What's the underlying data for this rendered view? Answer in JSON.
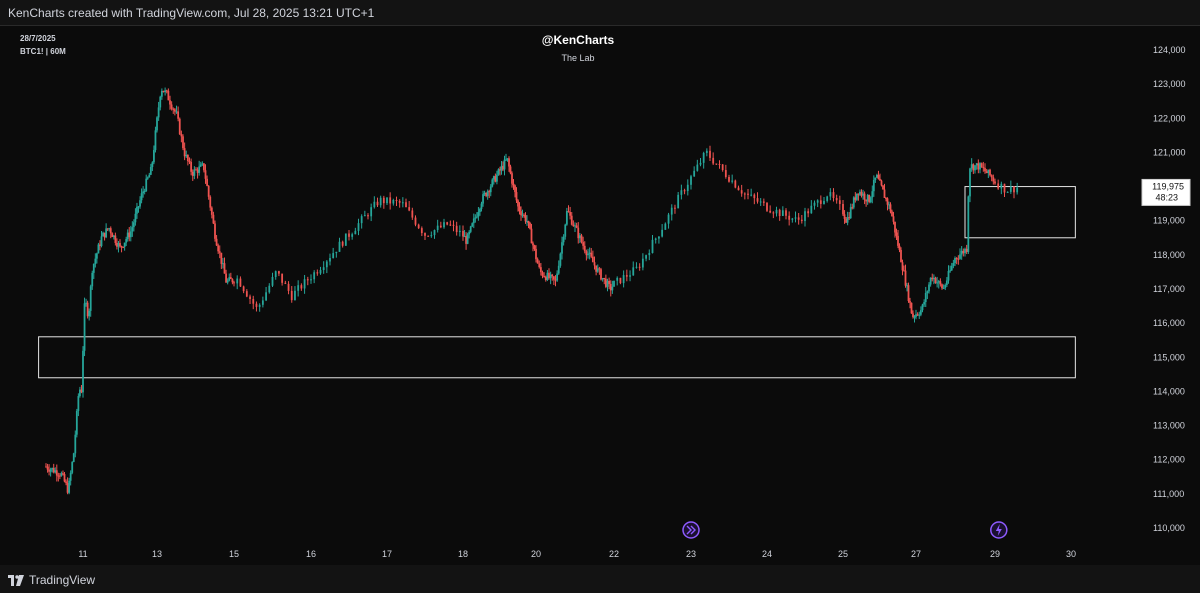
{
  "header": {
    "text": "KenCharts created with TradingView.com, Jul 28, 2025 13:21 UTC+1"
  },
  "chart_info": {
    "date": "28/7/2025",
    "symbol": "BTC1! | 60M"
  },
  "watermark": {
    "title": "@KenCharts",
    "subtitle": "The Lab"
  },
  "footer": {
    "brand": "TradingView"
  },
  "price_label": {
    "value": "119,975",
    "countdown": "48:23"
  },
  "colors": {
    "background": "#0b0b0b",
    "up": "#26a69a",
    "down": "#ef5350",
    "text": "#d1d4dc",
    "event": "#8e5bff"
  },
  "icons": [
    "merge-arrows-icon",
    "lightning-icon"
  ],
  "chart_data": {
    "type": "candlestick",
    "title": "",
    "ylim": [
      109500,
      124500
    ],
    "y_ticks": [
      "124,000",
      "123,000",
      "122,000",
      "121,000",
      "120,000",
      "119,000",
      "118,000",
      "117,000",
      "116,000",
      "115,000",
      "114,000",
      "113,000",
      "112,000",
      "111,000",
      "110,000"
    ],
    "x_ticks": [
      "11",
      "13",
      "15",
      "16",
      "17",
      "18",
      "20",
      "22",
      "23",
      "24",
      "25",
      "27",
      "29",
      "30"
    ],
    "price_path": [
      [
        10.0,
        111800
      ],
      [
        10.4,
        111600
      ],
      [
        10.6,
        111100
      ],
      [
        10.75,
        112200
      ],
      [
        10.9,
        114200
      ],
      [
        10.95,
        113800
      ],
      [
        11.05,
        116700
      ],
      [
        11.15,
        116200
      ],
      [
        11.25,
        117600
      ],
      [
        11.5,
        118500
      ],
      [
        11.7,
        118800
      ],
      [
        12.0,
        118200
      ],
      [
        12.3,
        118700
      ],
      [
        12.6,
        119800
      ],
      [
        12.85,
        120500
      ],
      [
        13.1,
        122900
      ],
      [
        13.25,
        122700
      ],
      [
        13.5,
        122100
      ],
      [
        13.7,
        121000
      ],
      [
        13.9,
        120400
      ],
      [
        14.2,
        120600
      ],
      [
        14.5,
        118600
      ],
      [
        14.8,
        117200
      ],
      [
        15.05,
        117300
      ],
      [
        15.3,
        116400
      ],
      [
        15.55,
        117500
      ],
      [
        15.75,
        116800
      ],
      [
        16.1,
        117600
      ],
      [
        16.5,
        118600
      ],
      [
        16.9,
        119600
      ],
      [
        17.2,
        119500
      ],
      [
        17.5,
        118600
      ],
      [
        17.8,
        118900
      ],
      [
        18.1,
        118400
      ],
      [
        18.5,
        119600
      ],
      [
        18.9,
        120300
      ],
      [
        19.2,
        120800
      ],
      [
        19.5,
        119400
      ],
      [
        19.75,
        119000
      ],
      [
        20.1,
        117500
      ],
      [
        20.5,
        117200
      ],
      [
        20.8,
        119300
      ],
      [
        21.2,
        118300
      ],
      [
        21.6,
        117500
      ],
      [
        21.9,
        117000
      ],
      [
        22.3,
        117600
      ],
      [
        22.6,
        118700
      ],
      [
        22.9,
        119900
      ],
      [
        23.2,
        121000
      ],
      [
        23.4,
        120500
      ],
      [
        23.7,
        119800
      ],
      [
        24.0,
        119400
      ],
      [
        24.4,
        119000
      ],
      [
        24.8,
        119800
      ],
      [
        25.1,
        119000
      ],
      [
        25.4,
        119900
      ],
      [
        25.7,
        119600
      ],
      [
        25.9,
        120300
      ],
      [
        26.3,
        119300
      ],
      [
        26.6,
        117800
      ],
      [
        26.9,
        116200
      ],
      [
        27.15,
        116400
      ],
      [
        27.4,
        117400
      ],
      [
        27.7,
        117000
      ],
      [
        28.0,
        117900
      ],
      [
        28.3,
        118200
      ],
      [
        28.35,
        120600
      ],
      [
        28.6,
        120600
      ],
      [
        28.9,
        120300
      ],
      [
        29.15,
        119900
      ],
      [
        29.3,
        119975
      ]
    ],
    "zones": [
      {
        "name": "resistance-zone",
        "x_range": [
          28.25,
          30.15
        ],
        "y_range": [
          118500,
          120000
        ]
      },
      {
        "name": "support-zone",
        "x_range": [
          9.8,
          30.15
        ],
        "y_range": [
          114400,
          115600
        ]
      }
    ],
    "last_price": 119975,
    "events": [
      {
        "x": 23.0,
        "icon": "merge-arrows-icon"
      },
      {
        "x": 29.05,
        "icon": "lightning-icon"
      }
    ]
  }
}
